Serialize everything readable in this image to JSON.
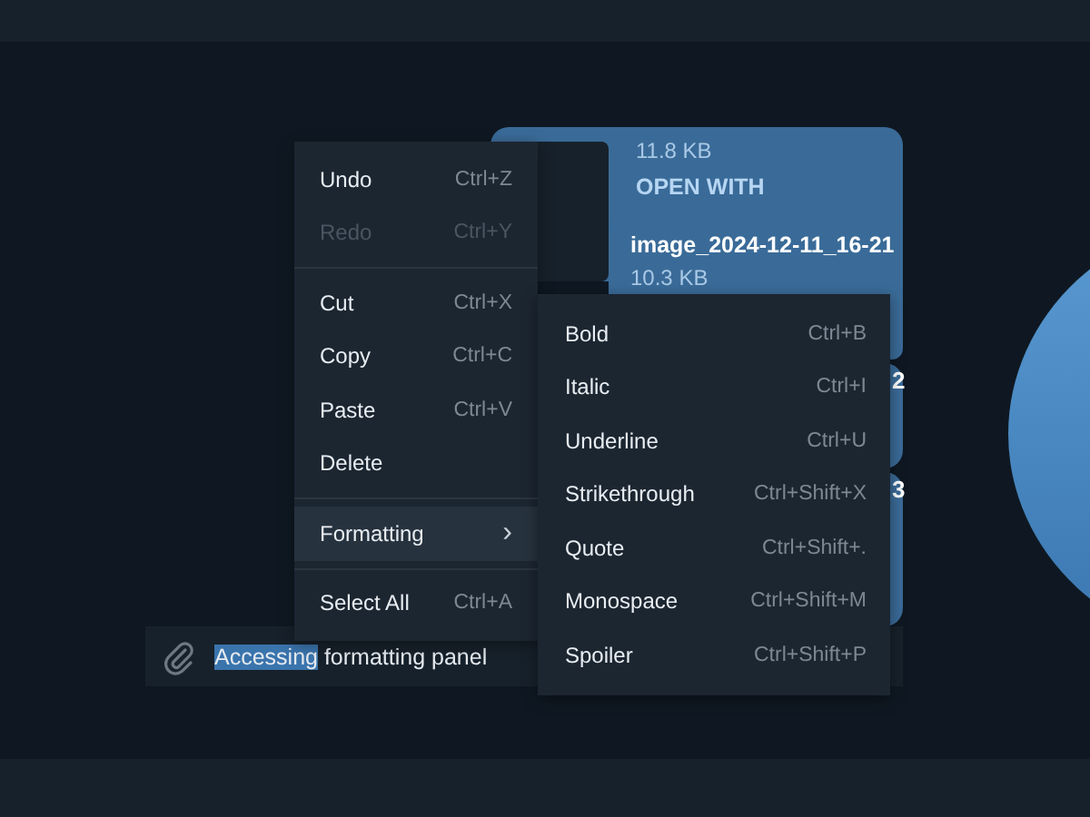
{
  "chat": {
    "messages": [
      {
        "size": "11.8 KB",
        "action": "OPEN WITH"
      },
      {
        "filename": "image_2024-12-11_16-21",
        "size": "10.3 KB"
      },
      {
        "filename": "2"
      },
      {
        "filename": "3"
      }
    ]
  },
  "context_menu": {
    "items": [
      {
        "kind": "item",
        "label": "Undo",
        "shortcut": "Ctrl+Z",
        "disabled": false
      },
      {
        "kind": "item",
        "label": "Redo",
        "shortcut": "Ctrl+Y",
        "disabled": true
      },
      {
        "kind": "separator"
      },
      {
        "kind": "item",
        "label": "Cut",
        "shortcut": "Ctrl+X",
        "disabled": false
      },
      {
        "kind": "item",
        "label": "Copy",
        "shortcut": "Ctrl+C",
        "disabled": false
      },
      {
        "kind": "item",
        "label": "Paste",
        "shortcut": "Ctrl+V",
        "disabled": false
      },
      {
        "kind": "item",
        "label": "Delete",
        "disabled": false
      },
      {
        "kind": "separator"
      },
      {
        "kind": "submenu",
        "label": "Formatting",
        "arrow": "›",
        "selected": true
      },
      {
        "kind": "separator"
      },
      {
        "kind": "item",
        "label": "Select All",
        "shortcut": "Ctrl+A",
        "disabled": false
      }
    ]
  },
  "formatting_menu": {
    "items": [
      {
        "label": "Bold",
        "shortcut": "Ctrl+B"
      },
      {
        "label": "Italic",
        "shortcut": "Ctrl+I"
      },
      {
        "label": "Underline",
        "shortcut": "Ctrl+U"
      },
      {
        "label": "Strikethrough",
        "shortcut": "Ctrl+Shift+X"
      },
      {
        "label": "Quote",
        "shortcut": "Ctrl+Shift+."
      },
      {
        "label": "Monospace",
        "shortcut": "Ctrl+Shift+M"
      },
      {
        "label": "Spoiler",
        "shortcut": "Ctrl+Shift+P"
      }
    ]
  },
  "composer": {
    "selected_text": "Accessing",
    "text": "formatting panel"
  }
}
